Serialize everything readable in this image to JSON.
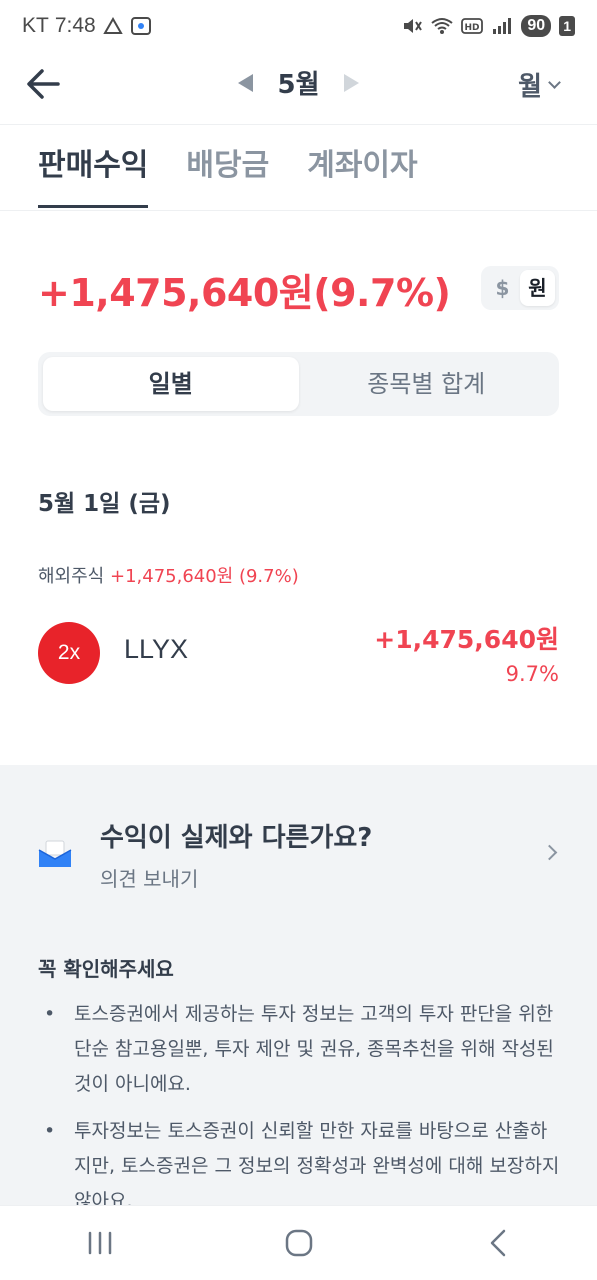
{
  "status_bar": {
    "carrier": "KT",
    "time": "7:48",
    "battery": "90",
    "sim": "1"
  },
  "header": {
    "month": "5월",
    "unit": "월"
  },
  "tabs": [
    {
      "label": "판매수익",
      "active": true
    },
    {
      "label": "배당금",
      "active": false
    },
    {
      "label": "계좌이자",
      "active": false
    }
  ],
  "summary": {
    "total": "+1,475,640원(9.7%)",
    "currency_options": [
      "$",
      "원"
    ],
    "selected_currency": "원"
  },
  "segment": {
    "options": [
      "일별",
      "종목별 합계"
    ],
    "selected": "일별"
  },
  "day": {
    "date": "5월 1일 (금)",
    "group_label": "해외주식",
    "group_value": "+1,475,640원 (9.7%)",
    "stock": {
      "logo_text": "2x",
      "name": "LLYX",
      "amount": "+1,475,640원",
      "percent": "9.7%"
    }
  },
  "feedback": {
    "title": "수익이 실제와 다른가요?",
    "subtitle": "의견 보내기"
  },
  "notice": {
    "title": "꼭 확인해주세요",
    "items": [
      "토스증권에서 제공하는 투자 정보는 고객의 투자 판단을 위한 단순 참고용일뿐, 투자 제안 및 권유, 종목추천을 위해 작성된 것이 아니에요.",
      "투자정보는 토스증권이 신뢰할 만한 자료를 바탕으로 산출하지만, 토스증권은 그 정보의 정확성과 완벽성에 대해 보장하지 않아요."
    ]
  },
  "colors": {
    "profit_red": "#f04452",
    "text_primary": "#333d4b",
    "text_secondary": "#8b95a1",
    "section_gray": "#f2f4f6",
    "stock_logo_red": "#e8232a"
  },
  "icons": [
    "back-arrow-icon",
    "prev-month-icon",
    "next-month-icon",
    "chevron-down-icon",
    "mail-icon",
    "chevron-right-icon",
    "recent-apps-icon",
    "home-icon",
    "nav-back-icon"
  ]
}
